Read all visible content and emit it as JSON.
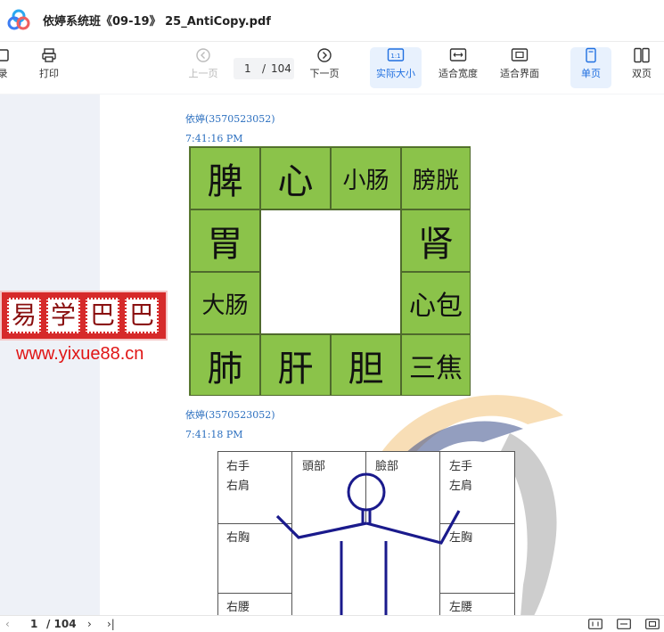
{
  "window": {
    "title": "依婷系统班《09-19》 25_AntiCopy.pdf"
  },
  "toolbar": {
    "catalog_label": "录",
    "print_label": "打印",
    "prev_label": "上一页",
    "page_current": "1",
    "page_sep": "/",
    "page_total": "104",
    "next_label": "下一页",
    "actual_size_label": "实际大小",
    "actual_size_icon_text": "1:1",
    "fit_width_label": "适合宽度",
    "fit_page_label": "适合界面",
    "single_page_label": "单页",
    "double_page_label": "双页"
  },
  "document": {
    "msg1_user": "依婷(3570523052)",
    "msg1_time": "7:41:16 PM",
    "msg2_user": "依婷(3570523052)",
    "msg2_time": "7:41:18 PM",
    "organ_grid": {
      "r1": [
        "脾",
        "心",
        "小肠",
        "膀胱"
      ],
      "r2_left": "胃",
      "r2_right": "肾",
      "r3_left": "大肠",
      "r3_right": "心包",
      "r4": [
        "肺",
        "肝",
        "胆",
        "三焦"
      ]
    },
    "body_grid": {
      "top_left_1": "右手",
      "top_left_2": "右肩",
      "top_mid_left": "頭部",
      "top_mid_right": "臉部",
      "top_right_1": "左手",
      "top_right_2": "左肩",
      "mid_left": "右胸",
      "mid_right": "左胸",
      "bot_left": "右腰",
      "bot_right": "左腰"
    }
  },
  "watermark": {
    "chars": [
      "易",
      "学",
      "巴",
      "巴"
    ],
    "url": "www.yixue88.cn"
  },
  "statusbar": {
    "prev_icon": "‹",
    "page_current": "1",
    "page_total": "/ 104",
    "next_icon": "›",
    "last_icon": "›|"
  },
  "colors": {
    "grid_green": "#8bc34a",
    "accent_blue": "#1f6fe0",
    "meta_blue": "#2b6fbf",
    "watermark_red": "#d62a2a",
    "figure_blue": "#1a1a8c"
  }
}
